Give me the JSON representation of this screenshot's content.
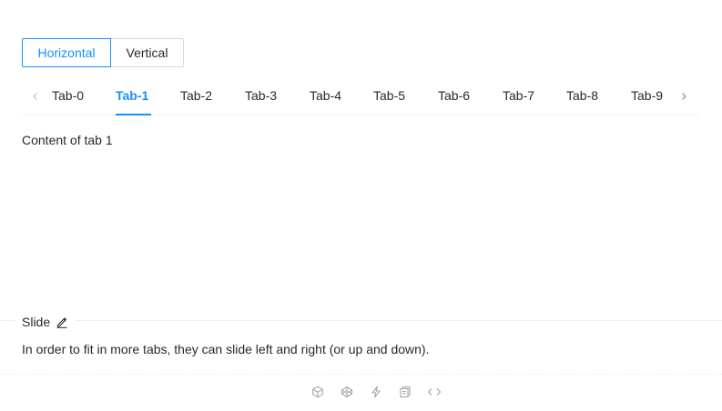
{
  "mode_switch": {
    "options": [
      {
        "label": "Horizontal",
        "selected": true
      },
      {
        "label": "Vertical",
        "selected": false
      }
    ]
  },
  "tabs": {
    "items": [
      {
        "label": "Tab-0"
      },
      {
        "label": "Tab-1"
      },
      {
        "label": "Tab-2"
      },
      {
        "label": "Tab-3"
      },
      {
        "label": "Tab-4"
      },
      {
        "label": "Tab-5"
      },
      {
        "label": "Tab-6"
      },
      {
        "label": "Tab-7"
      },
      {
        "label": "Tab-8"
      },
      {
        "label": "Tab-9"
      }
    ],
    "active_index": 1,
    "content": "Content of tab 1"
  },
  "demo_meta": {
    "title": "Slide",
    "description": "In order to fit in more tabs, they can slide left and right (or up and down)."
  },
  "icons": {
    "prev": "chevron-left-icon",
    "next": "chevron-right-icon",
    "edit": "edit-icon",
    "actions": [
      "codesandbox-icon",
      "codepen-icon",
      "thunderbolt-icon",
      "copy-icon",
      "code-icon"
    ]
  },
  "colors": {
    "accent": "#1890ff",
    "text": "rgba(0,0,0,0.85)",
    "border": "#d9d9d9",
    "divider": "#f0f0f0",
    "icon_muted": "#bfbfbf"
  }
}
